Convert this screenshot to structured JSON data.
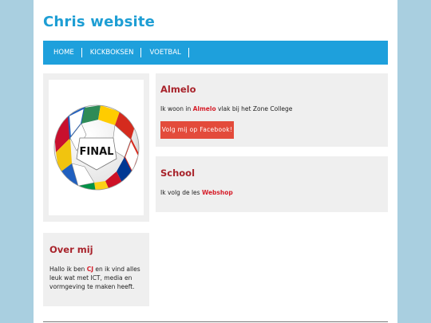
{
  "site": {
    "title": "Chris website"
  },
  "nav": {
    "items": [
      "HOME",
      "KICKBOKSEN",
      "VOETBAL"
    ]
  },
  "image": {
    "ball_text": "FINAL",
    "alt": "Football"
  },
  "about": {
    "title": "Over mij",
    "text_before": "Hallo ik ben ",
    "highlight": "CJ",
    "text_after": " en ik vind alles leuk wat met ICT, media en vormgeving te maken heeft."
  },
  "almelo": {
    "title": "Almelo",
    "text_before": "Ik woon in ",
    "highlight": "Almelo",
    "text_after": " vlak bij het Zone College",
    "button_label": "Volg mij op Facebook!"
  },
  "school": {
    "title": "School",
    "text_before": "Ik volg de les ",
    "highlight": "Webshop"
  },
  "colors": {
    "background": "#a9cfe0",
    "title": "#1e9ed4",
    "nav": "#1ea0dc",
    "heading": "#a8232b",
    "highlight": "#d6202c",
    "button": "#e34b3b"
  }
}
